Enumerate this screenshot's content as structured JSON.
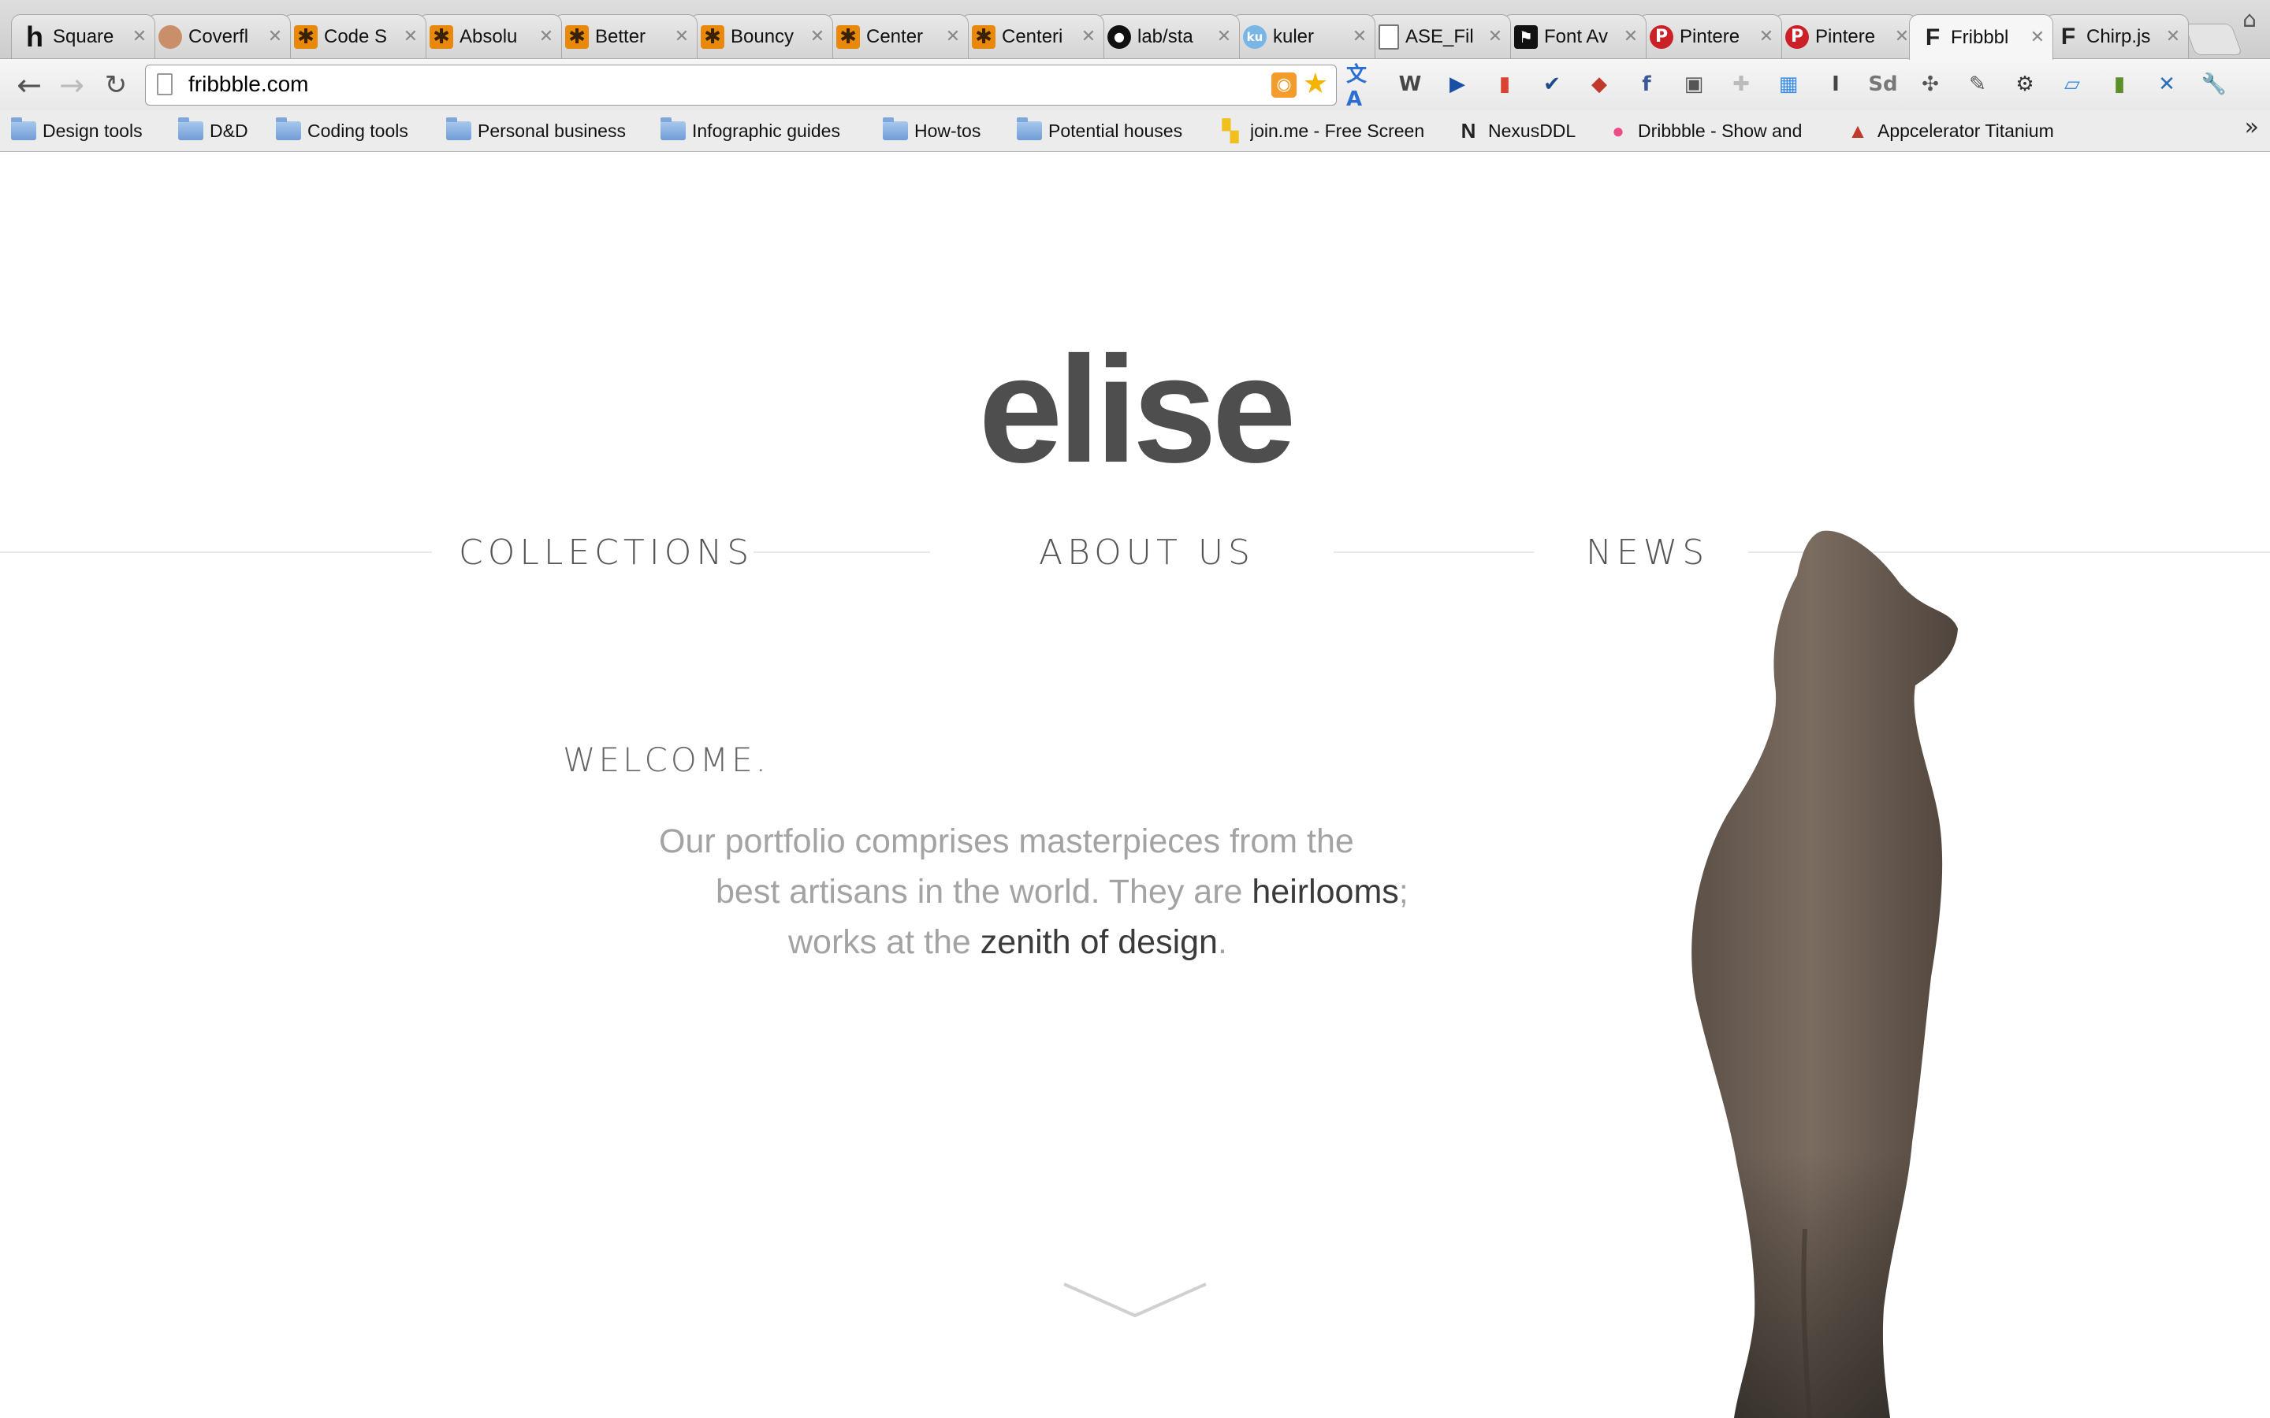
{
  "browser": {
    "tabs": [
      {
        "label": "Square",
        "icon": "h-logo-icon"
      },
      {
        "label": "Coverfl",
        "icon": "avatar-face-icon"
      },
      {
        "label": "Code S",
        "icon": "asterisk-star-icon"
      },
      {
        "label": "Absolu",
        "icon": "asterisk-star-icon"
      },
      {
        "label": "Better",
        "icon": "asterisk-star-icon"
      },
      {
        "label": "Bouncy",
        "icon": "asterisk-star-icon"
      },
      {
        "label": "Center",
        "icon": "asterisk-star-icon"
      },
      {
        "label": "Centeri",
        "icon": "asterisk-star-icon"
      },
      {
        "label": "lab/sta",
        "icon": "github-icon"
      },
      {
        "label": "kuler",
        "icon": "kuler-icon"
      },
      {
        "label": "ASE_Fil",
        "icon": "document-icon"
      },
      {
        "label": "Font Av",
        "icon": "flag-icon"
      },
      {
        "label": "Pintere",
        "icon": "pinterest-icon"
      },
      {
        "label": "Pintere",
        "icon": "pinterest-icon"
      },
      {
        "label": "Fribbbl",
        "icon": "f-letter-icon"
      },
      {
        "label": "Chirp.js",
        "icon": "f-letter-icon"
      }
    ],
    "active_tab_index": 14,
    "url": "fribbble.com",
    "bookmarks": [
      {
        "label": "Design tools",
        "icon": "folder-icon"
      },
      {
        "label": "D&D",
        "icon": "folder-icon"
      },
      {
        "label": "Coding tools",
        "icon": "folder-icon"
      },
      {
        "label": "Personal business",
        "icon": "folder-icon"
      },
      {
        "label": "Infographic guides",
        "icon": "folder-icon"
      },
      {
        "label": "How-tos",
        "icon": "folder-icon"
      },
      {
        "label": "Potential houses",
        "icon": "folder-icon"
      },
      {
        "label": "join.me - Free Screen",
        "icon": "joinme-icon"
      },
      {
        "label": "NexusDDL",
        "icon": "n-logo-icon"
      },
      {
        "label": "Dribbble - Show and",
        "icon": "dribbble-icon"
      },
      {
        "label": "Appcelerator Titanium",
        "icon": "appcelerator-icon"
      }
    ],
    "extensions": [
      {
        "glyph": "文A",
        "icon": "translate-icon",
        "color": "#2d6fd1"
      },
      {
        "glyph": "W",
        "icon": "wordpress-icon",
        "color": "#464646"
      },
      {
        "glyph": "▶",
        "icon": "play-circle-icon",
        "color": "#1a4fa8"
      },
      {
        "glyph": "▮",
        "icon": "bookmark-red-icon",
        "color": "#d94332"
      },
      {
        "glyph": "✔",
        "icon": "checkbox-icon",
        "color": "#1b4d8c"
      },
      {
        "glyph": "◆",
        "icon": "couch-icon",
        "color": "#c0392b"
      },
      {
        "glyph": "f",
        "icon": "facebook-icon",
        "color": "#3b5998"
      },
      {
        "glyph": "▣",
        "icon": "evernote-icon",
        "color": "#555555"
      },
      {
        "glyph": "✚",
        "icon": "disabled-plus-icon",
        "color": "#bbbbbb"
      },
      {
        "glyph": "▦",
        "icon": "calendar-icon",
        "color": "#3a8ee6"
      },
      {
        "glyph": "I",
        "icon": "text-box-icon",
        "color": "#444444"
      },
      {
        "glyph": "Sd",
        "icon": "sd-badge-icon",
        "color": "#777777"
      },
      {
        "glyph": "✣",
        "icon": "bug-icon",
        "color": "#555555"
      },
      {
        "glyph": "✎",
        "icon": "eyedropper-icon",
        "color": "#555555"
      },
      {
        "glyph": "⚙",
        "icon": "gear-icon",
        "color": "#333333"
      },
      {
        "glyph": "▱",
        "icon": "ruler-icon",
        "color": "#3a8ee6"
      },
      {
        "glyph": "▮",
        "icon": "battery-icon",
        "color": "#5a8f2a"
      },
      {
        "glyph": "✕",
        "icon": "close-box-icon",
        "color": "#2a6ebb"
      },
      {
        "glyph": "🔧",
        "icon": "wrench-icon",
        "color": "#555555"
      }
    ]
  },
  "page": {
    "logo": "elise",
    "nav": [
      {
        "label": "COLLECTIONS"
      },
      {
        "label": "ABOUT US"
      },
      {
        "label": "NEWS"
      }
    ],
    "welcome": "WELCOME.",
    "intro": {
      "line1": "Our portfolio comprises masterpieces from the",
      "line2_pre": "best artisans in the world. They are ",
      "line2_hl": "heirlooms",
      "line2_post": ";",
      "line3_pre": "works at the ",
      "line3_hl": "zenith of design",
      "line3_post": "."
    },
    "colors": {
      "logo": "#4e4e4e",
      "nav_text": "#555555",
      "intro_text": "#a3a3a3",
      "highlight": "#3a3a3a",
      "figure": "#6e6055"
    }
  }
}
